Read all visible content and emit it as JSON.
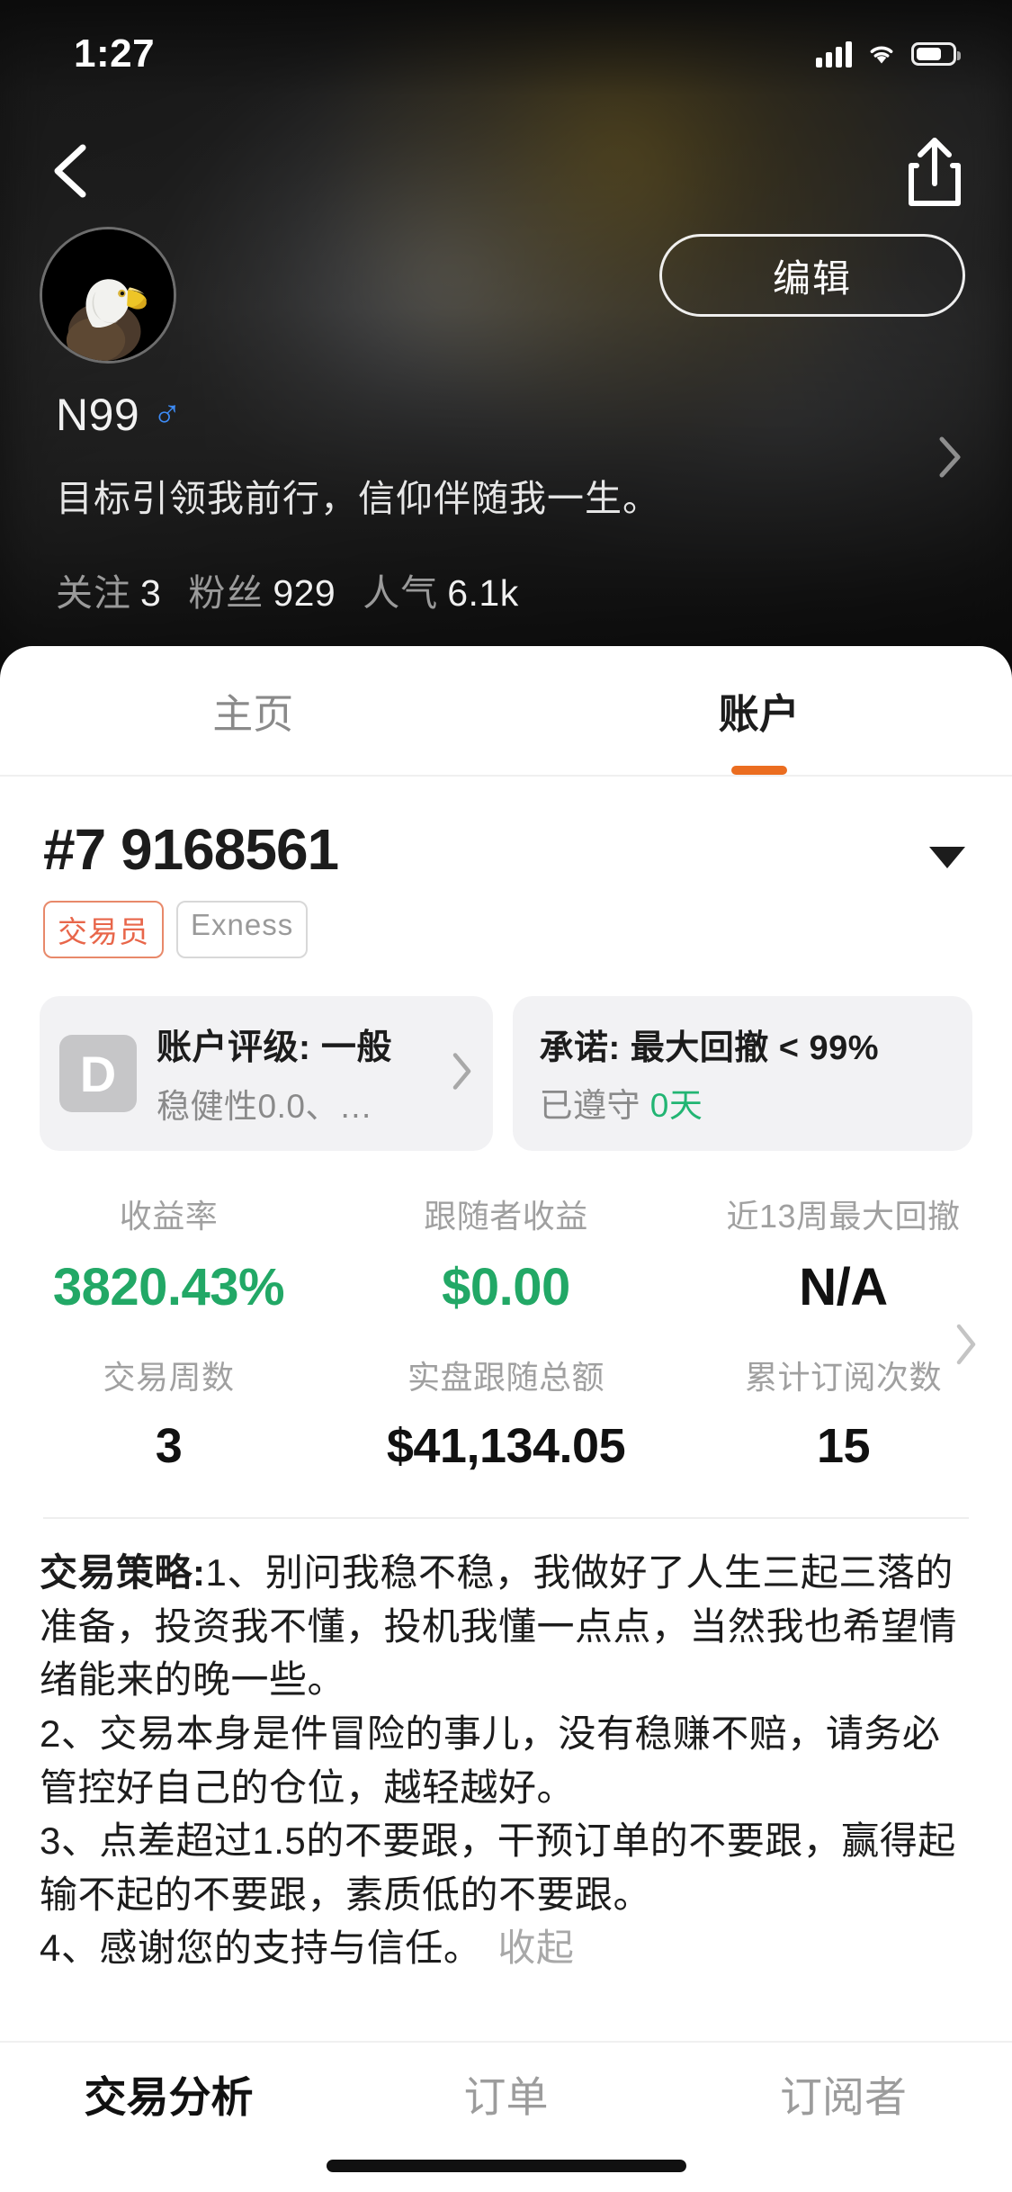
{
  "status_bar": {
    "time": "1:27",
    "signal_icon": "cellular-bars-icon",
    "wifi_icon": "wifi-icon",
    "battery_icon": "battery-icon"
  },
  "nav": {
    "back_icon": "back-chevron-icon",
    "share_icon": "share-icon"
  },
  "profile": {
    "avatar_icon": "eagle-avatar",
    "edit_label": "编辑",
    "username": "N99",
    "gender_symbol": "♂",
    "bio": "目标引领我前行，信仰伴随我一生。",
    "stats": [
      {
        "label": "关注",
        "value": "3"
      },
      {
        "label": "粉丝",
        "value": "929"
      },
      {
        "label": "人气",
        "value": "6.1k"
      }
    ],
    "chevron_icon": "chevron-right-icon"
  },
  "tabs": {
    "items": [
      {
        "label": "主页",
        "active": false
      },
      {
        "label": "账户",
        "active": true
      }
    ],
    "active_underline_color": "#EB6D20"
  },
  "account": {
    "number": "#7 9168561",
    "caret_icon": "chevron-down-icon",
    "badges": [
      {
        "label": "交易员",
        "color": "#E8664A"
      },
      {
        "label": "Exness",
        "color": "#9A9A9A"
      }
    ],
    "rating_card": {
      "grade": "D",
      "title": "账户评级: 一般",
      "subtitle": "稳健性0.0、…",
      "chevron_icon": "chevron-right-icon"
    },
    "promise_card": {
      "title": "承诺: 最大回撤 < 99%",
      "prefix": "已遵守",
      "days": "0天",
      "days_color": "#22B573"
    },
    "metrics_row1": [
      {
        "label": "收益率",
        "value": "3820.43%",
        "color": "green"
      },
      {
        "label": "跟随者收益",
        "value": "$0.00",
        "color": "green"
      },
      {
        "label": "近13周最大回撤",
        "value": "N/A",
        "color": "black"
      }
    ],
    "metrics_row2": [
      {
        "label": "交易周数",
        "value": "3",
        "color": "black"
      },
      {
        "label": "实盘跟随总额",
        "value": "$41,134.05",
        "color": "black"
      },
      {
        "label": "累计订阅次数",
        "value": "15",
        "color": "black"
      }
    ],
    "metrics_chevron_icon": "chevron-right-icon"
  },
  "strategy": {
    "heading": "交易策略:",
    "line1": "1、别问我稳不稳，我做好了人生三起三落的准备，投资我不懂，投机我懂一点点，当然我也希望情绪能来的晚一些。",
    "line2": "2、交易本身是件冒险的事儿，没有稳赚不赔，请务必管控好自己的仓位，越轻越好。",
    "line3": "3、点差超过1.5的不要跟，干预订单的不要跟，赢得起输不起的不要跟，素质低的不要跟。",
    "line4": "4、感谢您的支持与信任。",
    "collapse_label": "收起"
  },
  "bottom_tabs": {
    "items": [
      {
        "label": "交易分析",
        "active": true
      },
      {
        "label": "订单",
        "active": false
      },
      {
        "label": "订阅者",
        "active": false
      }
    ]
  }
}
